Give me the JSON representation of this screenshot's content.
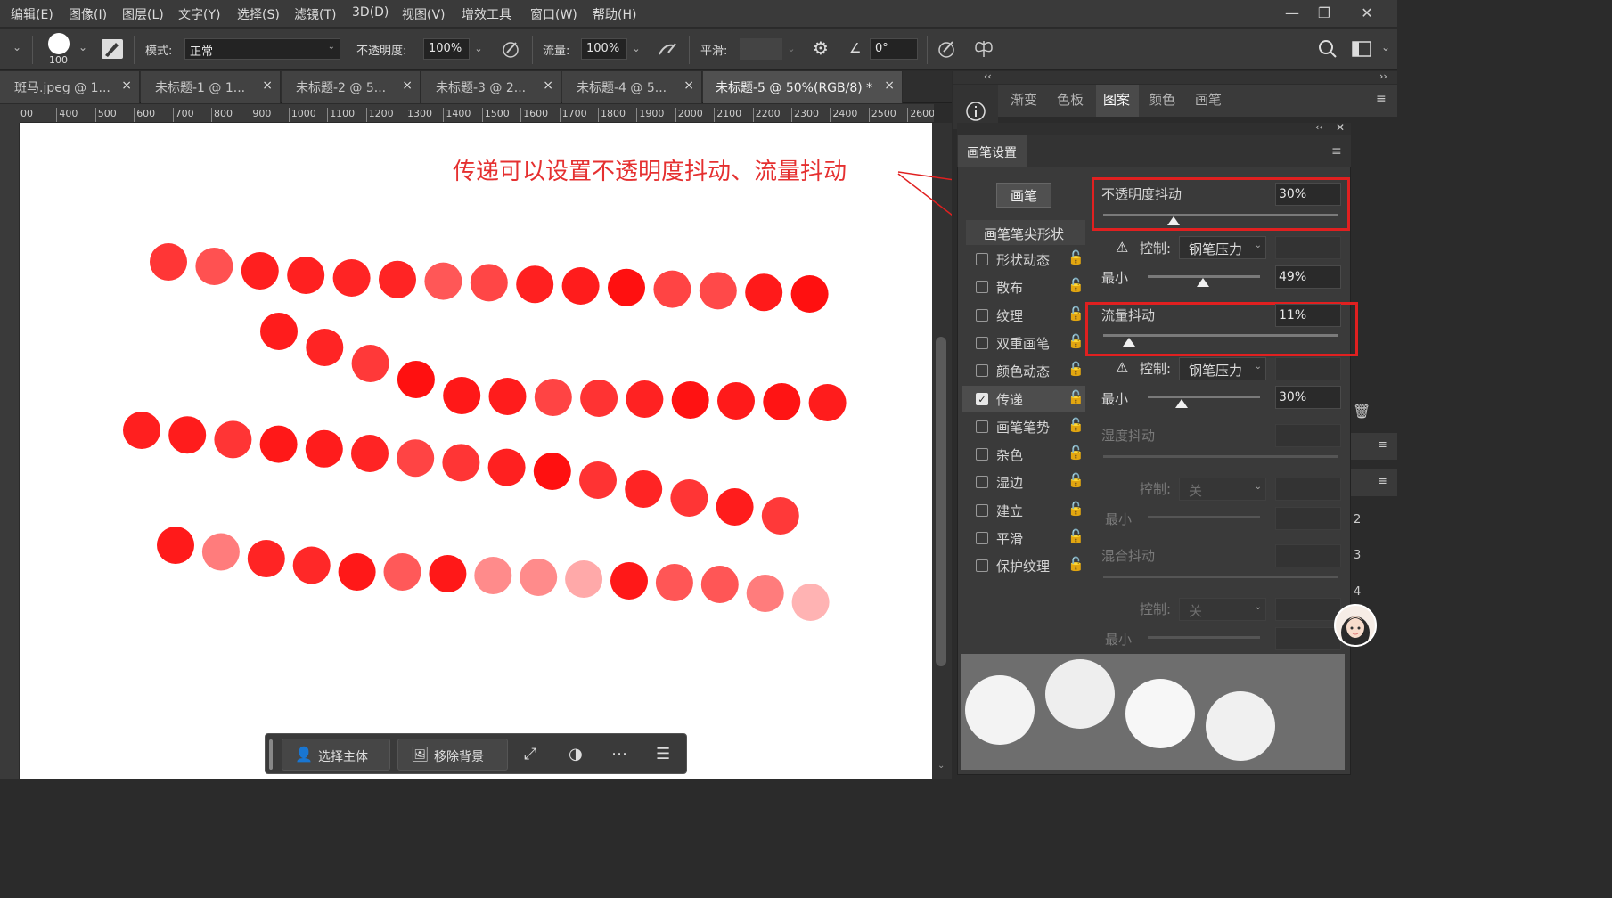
{
  "menu": [
    "编辑(E)",
    "图像(I)",
    "图层(L)",
    "文字(Y)",
    "选择(S)",
    "滤镜(T)",
    "3D(D)",
    "视图(V)",
    "增效工具",
    "窗口(W)",
    "帮助(H)"
  ],
  "window_controls": {
    "minimize": "—",
    "restore": "❐",
    "close": "✕"
  },
  "options": {
    "brush_size": "100",
    "mode_label": "模式:",
    "mode_value": "正常",
    "opacity_label": "不透明度:",
    "opacity_value": "100%",
    "flow_label": "流量:",
    "flow_value": "100%",
    "smooth_label": "平滑:",
    "smooth_value": "",
    "angle_value": "0°"
  },
  "tabs": [
    {
      "label": "斑马.jpeg @ 1...",
      "close": "×"
    },
    {
      "label": "未标题-1 @ 1...",
      "close": "×"
    },
    {
      "label": "未标题-2 @ 5...",
      "close": "×"
    },
    {
      "label": "未标题-3 @ 2...",
      "close": "×"
    },
    {
      "label": "未标题-4 @ 5...",
      "close": "×"
    },
    {
      "label": "未标题-5 @ 50%(RGB/8) *",
      "close": "×"
    }
  ],
  "ruler_ticks": [
    "00",
    "400",
    "500",
    "600",
    "700",
    "800",
    "900",
    "1000",
    "1100",
    "1200",
    "1300",
    "1400",
    "1500",
    "1600",
    "1700",
    "1800",
    "1900",
    "2000",
    "2100",
    "2200",
    "2300",
    "2400",
    "2500",
    "2600"
  ],
  "annotation": "传递可以设置不透明度抖动、流量抖动",
  "canvas_dots": [
    [
      {
        "c": "#ff2b2b",
        "a": 0.95
      },
      {
        "c": "#ff3333",
        "a": 0.85
      },
      {
        "c": "#ff1f1f",
        "a": 1
      },
      {
        "c": "#ff2020",
        "a": 1
      },
      {
        "c": "#ff2424",
        "a": 1
      },
      {
        "c": "#ff2424",
        "a": 1
      },
      {
        "c": "#ff3a3a",
        "a": 0.85
      },
      {
        "c": "#ff3232",
        "a": 0.9
      },
      {
        "c": "#ff2020",
        "a": 1
      },
      {
        "c": "#ff1c1c",
        "a": 1
      },
      {
        "c": "#ff1010",
        "a": 1
      },
      {
        "c": "#ff3030",
        "a": 0.9
      },
      {
        "c": "#ff3535",
        "a": 0.9
      },
      {
        "c": "#ff1a1a",
        "a": 1
      },
      {
        "c": "#ff1010",
        "a": 1
      }
    ],
    [
      {
        "c": "#ff1c1c",
        "a": 1
      },
      {
        "c": "#ff2424",
        "a": 1
      },
      {
        "c": "#ff2e2e",
        "a": 0.95
      },
      {
        "c": "#ff1010",
        "a": 1
      },
      {
        "c": "#ff1818",
        "a": 1
      },
      {
        "c": "#ff1c1c",
        "a": 1
      },
      {
        "c": "#ff3030",
        "a": 0.9
      },
      {
        "c": "#ff2828",
        "a": 0.95
      },
      {
        "c": "#ff2222",
        "a": 1
      },
      {
        "c": "#ff1212",
        "a": 1
      },
      {
        "c": "#ff1a1a",
        "a": 1
      },
      {
        "c": "#ff1414",
        "a": 1
      },
      {
        "c": "#ff1c1c",
        "a": 1
      }
    ],
    [
      {
        "c": "#ff1f1f",
        "a": 1
      },
      {
        "c": "#ff1c1c",
        "a": 1
      },
      {
        "c": "#ff2a2a",
        "a": 0.95
      },
      {
        "c": "#ff1818",
        "a": 1
      },
      {
        "c": "#ff1c1c",
        "a": 1
      },
      {
        "c": "#ff2424",
        "a": 1
      },
      {
        "c": "#ff3030",
        "a": 0.9
      },
      {
        "c": "#ff2a2a",
        "a": 0.95
      },
      {
        "c": "#ff2020",
        "a": 1
      },
      {
        "c": "#ff1010",
        "a": 1
      },
      {
        "c": "#ff2828",
        "a": 0.95
      },
      {
        "c": "#ff2424",
        "a": 1
      },
      {
        "c": "#ff2a2a",
        "a": 0.95
      },
      {
        "c": "#ff1c1c",
        "a": 1
      },
      {
        "c": "#ff2e2e",
        "a": 0.95
      }
    ],
    [
      {
        "c": "#ff1a1a",
        "a": 1
      },
      {
        "c": "#ff5050",
        "a": 0.75
      },
      {
        "c": "#ff2424",
        "a": 1
      },
      {
        "c": "#ff2828",
        "a": 1
      },
      {
        "c": "#ff1818",
        "a": 1
      },
      {
        "c": "#ff3c3c",
        "a": 0.85
      },
      {
        "c": "#ff1818",
        "a": 1
      },
      {
        "c": "#ff5a5a",
        "a": 0.7
      },
      {
        "c": "#ff5a5a",
        "a": 0.7
      },
      {
        "c": "#ff7070",
        "a": 0.6
      },
      {
        "c": "#ff1818",
        "a": 1
      },
      {
        "c": "#ff3838",
        "a": 0.85
      },
      {
        "c": "#ff3838",
        "a": 0.85
      },
      {
        "c": "#ff5050",
        "a": 0.75
      },
      {
        "c": "#ff8080",
        "a": 0.6
      }
    ]
  ],
  "context_bar": {
    "select_subject": "选择主体",
    "remove_bg": "移除背景"
  },
  "panel_tabs": [
    "渐变",
    "色板",
    "图案",
    "颜色",
    "画笔"
  ],
  "brush_settings": {
    "title": "画笔设置",
    "brush_button": "画笔",
    "tip_shape": "画笔笔尖形状",
    "options": [
      {
        "label": "形状动态",
        "checked": false
      },
      {
        "label": "散布",
        "checked": false
      },
      {
        "label": "纹理",
        "checked": false
      },
      {
        "label": "双重画笔",
        "checked": false
      },
      {
        "label": "颜色动态",
        "checked": false
      },
      {
        "label": "传递",
        "checked": true
      },
      {
        "label": "画笔笔势",
        "checked": false
      },
      {
        "label": "杂色",
        "checked": false
      },
      {
        "label": "湿边",
        "checked": false
      },
      {
        "label": "建立",
        "checked": false
      },
      {
        "label": "平滑",
        "checked": false
      },
      {
        "label": "保护纹理",
        "checked": false
      }
    ],
    "opacity_jitter": {
      "label": "不透明度抖动",
      "value": "30%",
      "level": 0.3
    },
    "control1": {
      "label": "控制:",
      "value": "钢笔压力"
    },
    "min1": {
      "label": "最小",
      "value": "49%",
      "level": 0.49
    },
    "flow_jitter": {
      "label": "流量抖动",
      "value": "11%",
      "level": 0.11
    },
    "control2": {
      "label": "控制:",
      "value": "钢笔压力"
    },
    "min2": {
      "label": "最小",
      "value": "30%",
      "level": 0.3
    },
    "wet_jitter": {
      "label": "湿度抖动"
    },
    "control3": {
      "label": "控制:",
      "value": "关"
    },
    "min3": {
      "label": "最小"
    },
    "mix_jitter": {
      "label": "混合抖动"
    },
    "control4": {
      "label": "控制:",
      "value": "关"
    },
    "min4": {
      "label": "最小"
    }
  },
  "edge_numbers": [
    "2",
    "3",
    "4"
  ]
}
